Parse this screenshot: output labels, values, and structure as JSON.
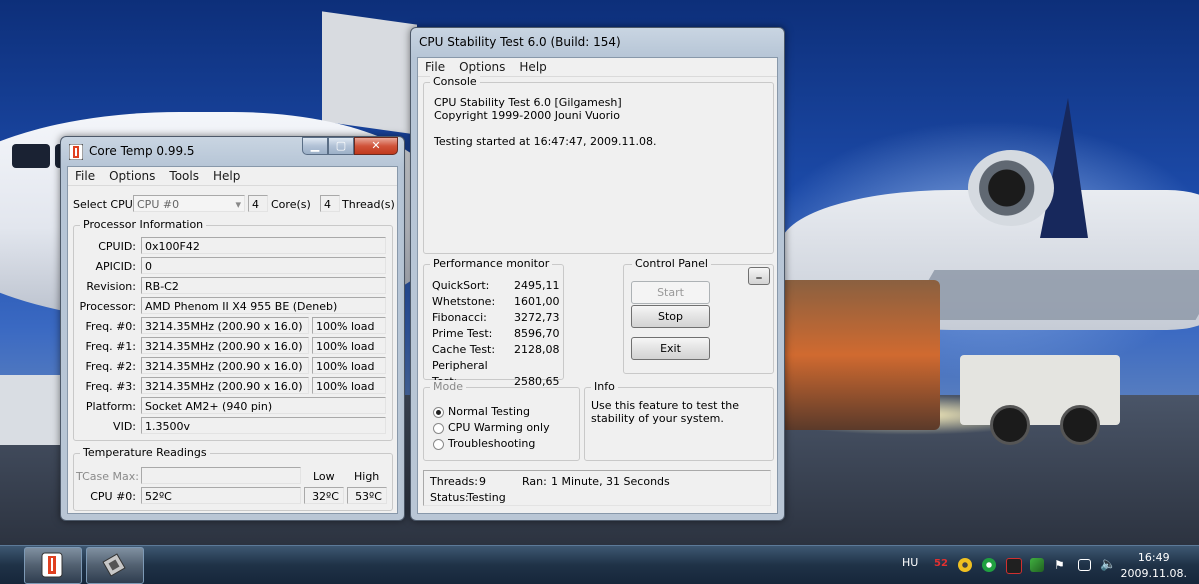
{
  "coretemp": {
    "title": "Core Temp 0.99.5",
    "menu": [
      "File",
      "Options",
      "Tools",
      "Help"
    ],
    "select_cpu_label": "Select CPU:",
    "select_cpu_value": "CPU #0",
    "cores_count": "4",
    "cores_label": "Core(s)",
    "threads_count": "4",
    "threads_label": "Thread(s)",
    "processor_info_label": "Processor Information",
    "cpuid_label": "CPUID:",
    "cpuid": "0x100F42",
    "apicid_label": "APICID:",
    "apicid": "0",
    "revision_label": "Revision:",
    "revision": "RB-C2",
    "processor_label": "Processor:",
    "processor": "AMD Phenom II X4 955 BE (Deneb)",
    "freqs": [
      {
        "label": "Freq. #0:",
        "value": "3214.35MHz (200.90 x 16.0)",
        "load": "100% load"
      },
      {
        "label": "Freq. #1:",
        "value": "3214.35MHz (200.90 x 16.0)",
        "load": "100% load"
      },
      {
        "label": "Freq. #2:",
        "value": "3214.35MHz (200.90 x 16.0)",
        "load": "100% load"
      },
      {
        "label": "Freq. #3:",
        "value": "3214.35MHz (200.90 x 16.0)",
        "load": "100% load"
      }
    ],
    "platform_label": "Platform:",
    "platform": "Socket AM2+ (940 pin)",
    "vid_label": "VID:",
    "vid": "1.3500v",
    "temp_readings_label": "Temperature Readings",
    "tcase_label": "TCase Max:",
    "tcase": "",
    "low_label": "Low",
    "high_label": "High",
    "cpu0_label": "CPU #0:",
    "cpu0_temp": "52ºC",
    "cpu0_low": "32ºC",
    "cpu0_high": "53ºC"
  },
  "cst": {
    "title": "CPU Stability Test 6.0 (Build: 154)",
    "menu": [
      "File",
      "Options",
      "Help"
    ],
    "console_label": "Console",
    "console_lines": [
      "CPU Stability Test 6.0 [Gilgamesh]",
      "Copyright 1999-2000 Jouni Vuorio",
      "",
      "Testing started at 16:47:47, 2009.11.08."
    ],
    "perf_label": "Performance monitor",
    "perf": [
      {
        "name": "QuickSort:",
        "value": "2495,11"
      },
      {
        "name": "Whetstone:",
        "value": "1601,00"
      },
      {
        "name": "Fibonacci:",
        "value": "3272,73"
      },
      {
        "name": "Prime Test:",
        "value": "8596,70"
      },
      {
        "name": "Cache Test:",
        "value": "2128,08"
      },
      {
        "name": "Peripheral Test:",
        "value": "2580,65"
      }
    ],
    "control_label": "Control Panel",
    "collapse_btn": "_",
    "start_btn": "Start",
    "stop_btn": "Stop",
    "exit_btn": "Exit",
    "mode_label": "Mode",
    "modes": [
      "Normal Testing",
      "CPU Warming only",
      "Troubleshooting"
    ],
    "mode_selected": 0,
    "info_label": "Info",
    "info_text": "Use this feature to test the stability of your system.",
    "threads_label": "Threads:",
    "threads_value": "9",
    "ran_label": "Ran:",
    "ran_value": "1 Minute, 31 Seconds",
    "status_label": "Status:",
    "status_value": "Testing"
  },
  "taskbar": {
    "lang": "HU",
    "tray_temp": "52",
    "clock_time": "16:49",
    "clock_date": "2009.11.08."
  },
  "colors": {
    "tray_temp": "#e03030",
    "window_frame": "#b6c5d6",
    "taskbar": "#1f3247"
  }
}
